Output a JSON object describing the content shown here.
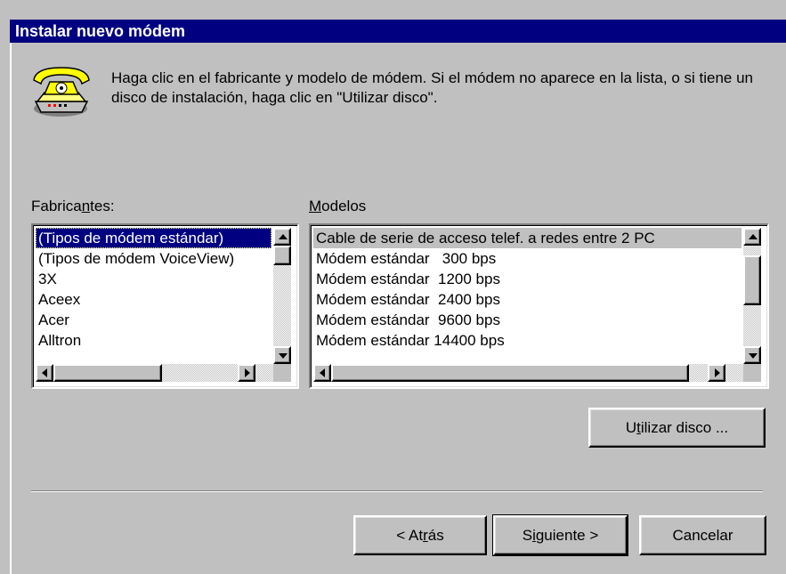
{
  "window": {
    "title": "Instalar nuevo módem"
  },
  "instructions": {
    "text": "Haga clic en el fabricante y modelo de módem. Si el módem no aparece en la lista, o si tiene un disco de instalación, haga clic en \"Utilizar disco\"."
  },
  "manufacturers": {
    "label_before": "Fabrica",
    "label_underlined": "n",
    "label_after": "tes:",
    "items": [
      "(Tipos de módem estándar)",
      "(Tipos de módem VoiceView)",
      "3X",
      "Aceex",
      "Acer",
      "Alltron"
    ],
    "selected_index": 0
  },
  "models": {
    "label_underlined": "M",
    "label_after": "odelos",
    "items": [
      "Cable de serie de acceso telef. a redes entre 2 PC",
      "Módem estándar   300 bps",
      "Módem estándar  1200 bps",
      "Módem estándar  2400 bps",
      "Módem estándar  9600 bps",
      "Módem estándar 14400 bps"
    ],
    "selected_index": 0
  },
  "buttons": {
    "utilizar_disco_before": "U",
    "utilizar_disco_underlined": "t",
    "utilizar_disco_after": "ilizar disco ...",
    "atras_before": "< At",
    "atras_underlined": "r",
    "atras_after": "ás",
    "siguiente_before": "S",
    "siguiente_underlined": "i",
    "siguiente_after": "guiente >",
    "cancelar": "Cancelar"
  },
  "colors": {
    "title_bar": "#000080",
    "face": "#c0c0c0",
    "selection": "#000080"
  },
  "icons": {
    "modem_icon": "telephone-modem-icon"
  }
}
